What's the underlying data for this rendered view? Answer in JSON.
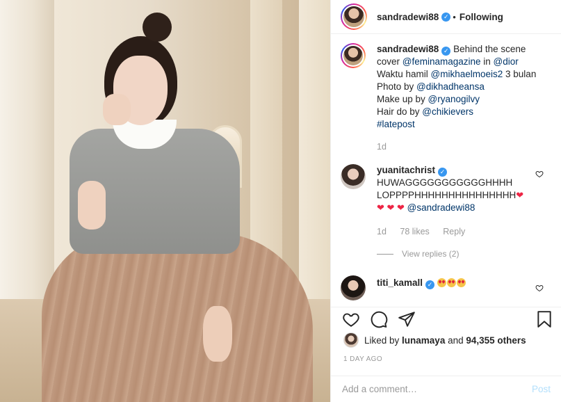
{
  "header": {
    "username": "sandradewi88",
    "separator": "•",
    "follow_status": "Following"
  },
  "caption": {
    "username": "sandradewi88",
    "line1_text": "Behind the scene",
    "line2_text": "cover ",
    "line2_mention1": "@feminamagazine",
    "line2_in": " in ",
    "line2_mention2": "@dior",
    "line3_text": "Waktu hamil ",
    "line3_mention": "@mikhaelmoeis2",
    "line3_tail": " 3 bulan",
    "line4_text": "Photo by ",
    "line4_mention": "@dikhadheansa",
    "line5_text": "Make up by ",
    "line5_mention": "@ryanogilvy",
    "line6_text": "Hair do by ",
    "line6_mention": "@chikievers",
    "hashtag": "#latepost",
    "time": "1d"
  },
  "comment1": {
    "username": "yuanitachrist",
    "line1": "HUWAGGGGGGGGGGGHHHH",
    "line2": "LOPPPPHHHHHHHHHHHHHHH",
    "line2_heart": "❤",
    "line3_hearts": "❤ ❤ ❤",
    "mention": "@sandradewi88",
    "time": "1d",
    "likes": "78 likes",
    "reply": "Reply",
    "view_replies": "View replies (2)"
  },
  "comment2": {
    "username": "titi_kamall",
    "emoji_names": [
      "heart-eyes-emoji",
      "heart-eyes-emoji",
      "heart-eyes-emoji"
    ]
  },
  "likes": {
    "prefix": "Liked by ",
    "liker": "lunamaya",
    "middle": " and ",
    "others": "94,355 others"
  },
  "timestamp": "1 DAY AGO",
  "add_comment": {
    "placeholder": "Add a comment…",
    "post_label": "Post"
  },
  "icons": [
    "heart-icon",
    "comment-icon",
    "share-icon",
    "bookmark-icon",
    "verified-badge-icon"
  ],
  "colors": {
    "verified": "#3897f0",
    "link": "#003569",
    "muted": "#999999",
    "post_button": "#b2dffc"
  }
}
